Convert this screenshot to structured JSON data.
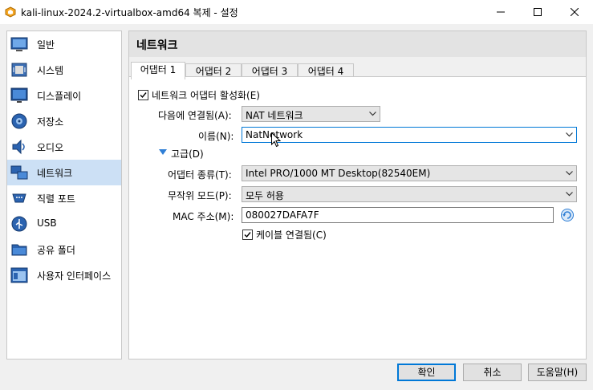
{
  "window": {
    "title": "kali-linux-2024.2-virtualbox-amd64 복제 - 설정"
  },
  "sidebar": {
    "items": [
      {
        "label": "일반",
        "icon": "general-icon"
      },
      {
        "label": "시스템",
        "icon": "system-chip-icon"
      },
      {
        "label": "디스플레이",
        "icon": "monitor-icon"
      },
      {
        "label": "저장소",
        "icon": "disk-icon"
      },
      {
        "label": "오디오",
        "icon": "speaker-icon"
      },
      {
        "label": "네트워크",
        "icon": "network-icon",
        "selected": true
      },
      {
        "label": "직렬 포트",
        "icon": "serial-port-icon"
      },
      {
        "label": "USB",
        "icon": "usb-icon"
      },
      {
        "label": "공유 폴더",
        "icon": "folder-icon"
      },
      {
        "label": "사용자 인터페이스",
        "icon": "ui-window-icon"
      }
    ]
  },
  "panel": {
    "title": "네트워크"
  },
  "tabs": [
    "어댑터 1",
    "어댑터 2",
    "어댑터 3",
    "어댑터 4"
  ],
  "adapter": {
    "enable_label": "네트워크 어댑터 활성화(E)",
    "enable_checked": true,
    "attached_label": "다음에 연결됨(A):",
    "attached_value": "NAT 네트워크",
    "name_label": "이름(N):",
    "name_value": "NatNetwork",
    "advanced_label": "고급(D)",
    "type_label": "어댑터 종류(T):",
    "type_value": "Intel PRO/1000 MT Desktop(82540EM)",
    "promisc_label": "무작위 모드(P):",
    "promisc_value": "모두 허용",
    "mac_label": "MAC 주소(M):",
    "mac_value": "080027DAFA7F",
    "cable_label": "케이블 연결됨(C)",
    "cable_checked": true
  },
  "buttons": {
    "ok": "확인",
    "cancel": "취소",
    "help": "도움말(H)"
  },
  "colors": {
    "accent": "#0078d7",
    "selection": "#cce0f5"
  }
}
